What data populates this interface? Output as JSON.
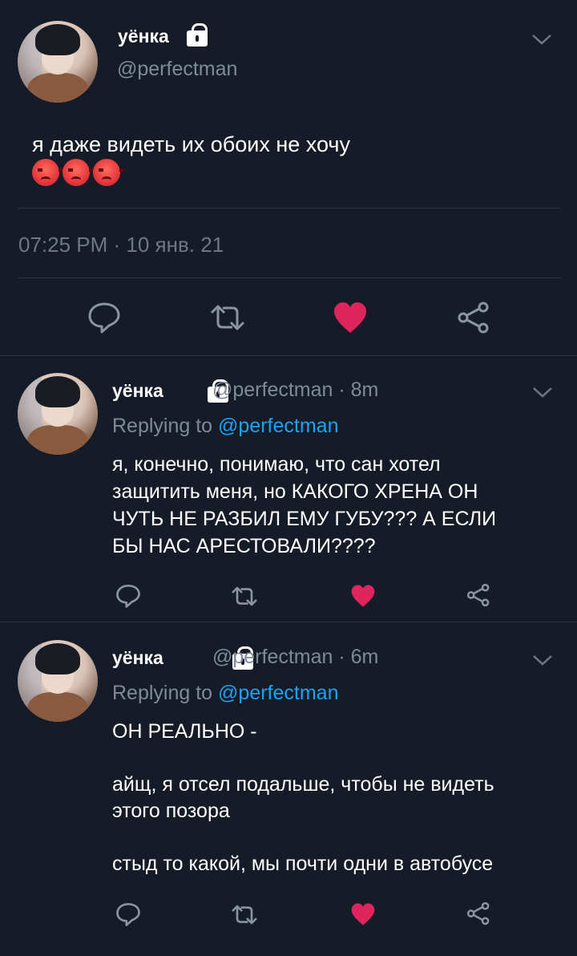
{
  "tweet_main": {
    "name": "уёнка",
    "handle": "@perfectman",
    "text": "я даже видеть их обоих не хочу",
    "timestamp": "07:25 PM · 10 янв. 21"
  },
  "replies": [
    {
      "name": "уёнка",
      "handle": "@perfectman · 8m",
      "replying_prefix": "Replying to ",
      "replying_mention": "@perfectman",
      "text": "я, конечно, понимаю, что сан хотел\nзащитить меня, но КАКОГО ХРЕНА ОН\nЧУТЬ НЕ РАЗБИЛ ЕМУ ГУБУ??? А ЕСЛИ\nБЫ НАС АРЕСТОВАЛИ????"
    },
    {
      "name": "уёнка",
      "handle": "@perfectman · 6m",
      "replying_prefix": "Replying to ",
      "replying_mention": "@perfectman",
      "text": "ОН РЕАЛЬНО -\n\nайщ, я отсел подальше, чтобы не видеть\nэтого позора\n\nстыд то какой, мы почти одни в автобусе"
    }
  ],
  "colors": {
    "background": "#151b27",
    "like_red": "#e0245e",
    "mention_blue": "#1da1f2",
    "muted_gray": "#7f8a99"
  }
}
